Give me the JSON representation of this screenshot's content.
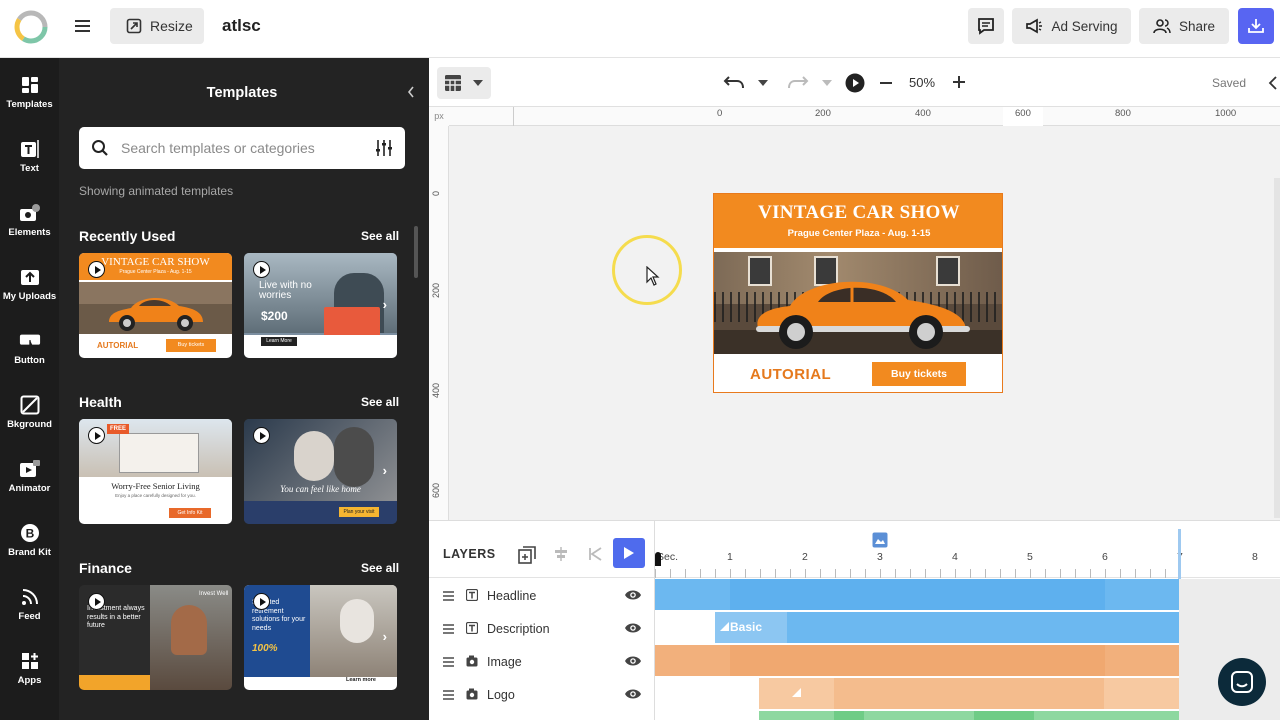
{
  "topbar": {
    "resize_label": "Resize",
    "doc_title": "atlsc",
    "ad_serving_label": "Ad Serving",
    "share_label": "Share"
  },
  "rail": {
    "items": [
      {
        "label": "Templates",
        "icon": "templates-icon"
      },
      {
        "label": "Text",
        "icon": "text-icon"
      },
      {
        "label": "Elements",
        "icon": "elements-icon"
      },
      {
        "label": "My Uploads",
        "icon": "uploads-icon"
      },
      {
        "label": "Button",
        "icon": "button-icon"
      },
      {
        "label": "Bkground",
        "icon": "background-icon"
      },
      {
        "label": "Animator",
        "icon": "animator-icon"
      },
      {
        "label": "Brand Kit",
        "icon": "brand-kit-icon"
      },
      {
        "label": "Feed",
        "icon": "feed-icon"
      },
      {
        "label": "Apps",
        "icon": "apps-icon"
      }
    ]
  },
  "panel": {
    "title": "Templates",
    "search_placeholder": "Search templates or categories",
    "showing_text": "Showing animated templates",
    "sections": [
      {
        "title": "Recently Used",
        "see_all": "See all"
      },
      {
        "title": "Health",
        "see_all": "See all"
      },
      {
        "title": "Finance",
        "see_all": "See all"
      }
    ],
    "thumbs": {
      "t1_title": "VINTAGE CAR SHOW",
      "t1_sub": "Prague Center Plaza - Aug. 1-15",
      "t1_logo": "AUTORIAL",
      "t1_btn": "Buy tickets",
      "t2_title": "Live with no worries",
      "t2_price": "$200",
      "t2_btn": "Learn More",
      "t3_badge": "FREE",
      "t3_title": "Worry-Free Senior Living",
      "t3_sub": "Enjoy a place carefully designed for you.",
      "t3_btn": "Get Info Kit",
      "t4_title": "You can feel like home",
      "t4_btn": "Plan your visit",
      "t5_title": "Investment always results in a better future",
      "t5_head": "Invest Well",
      "t6_title": "Selected retirement solutions for your needs",
      "t6_pct": "100%",
      "t6_btn": "Learn more"
    }
  },
  "canvas": {
    "zoom": "50%",
    "status": "Saved",
    "ruler_unit": "px",
    "ruler_h": [
      "0",
      "200",
      "400",
      "600",
      "800",
      "1000"
    ],
    "ruler_v": [
      "0",
      "200",
      "400",
      "600"
    ]
  },
  "banner": {
    "headline": "VINTAGE CAR SHOW",
    "description": "Prague Center Plaza - Aug. 1-15",
    "logo": "AUTORIAL",
    "button": "Buy tickets"
  },
  "layers": {
    "title": "LAYERS",
    "items": [
      {
        "name": "Headline",
        "type": "text"
      },
      {
        "name": "Description",
        "type": "text"
      },
      {
        "name": "Image",
        "type": "image"
      },
      {
        "name": "Logo",
        "type": "image"
      }
    ]
  },
  "timeline": {
    "labels": [
      "Sec.",
      "1",
      "2",
      "3",
      "4",
      "5",
      "6",
      "7",
      "8"
    ],
    "basic_label": "Basic"
  },
  "colors": {
    "accent": "#5865f2",
    "orange": "#f28a1f",
    "timeline_blue": "#6cb8f0",
    "timeline_orange": "#f2b07c"
  }
}
